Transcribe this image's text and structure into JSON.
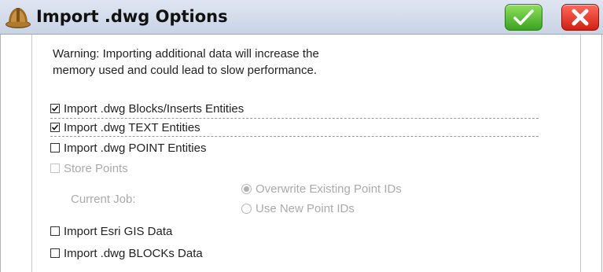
{
  "window": {
    "title": "Import .dwg Options",
    "app_icon": "hard-hat-icon",
    "accept_icon": "checkmark-icon",
    "close_icon": "close-x-icon"
  },
  "warning_text": "Warning: Importing additional data will increase the memory used and could lead to slow performance.",
  "options": {
    "blocks_inserts": {
      "label": "Import .dwg Blocks/Inserts Entities",
      "checked": true
    },
    "text_entities": {
      "label": "Import .dwg TEXT Entities",
      "checked": true
    },
    "point_entities": {
      "label": "Import .dwg POINT Entities",
      "checked": false
    },
    "store_points": {
      "label": "Store Points",
      "checked": false,
      "enabled": false
    },
    "current_job": {
      "label": "Current Job:",
      "choices": [
        {
          "label": "Overwrite Existing Point IDs",
          "selected": true
        },
        {
          "label": "Use New Point IDs",
          "selected": false
        }
      ]
    },
    "esri_gis": {
      "label": "Import Esri GIS Data",
      "checked": false
    },
    "blocks_data": {
      "label": "Import .dwg BLOCKs Data",
      "checked": false
    }
  },
  "colors": {
    "accept_button": "#3aa321",
    "close_button": "#d31f12",
    "disabled_text": "#aaaaaa"
  }
}
